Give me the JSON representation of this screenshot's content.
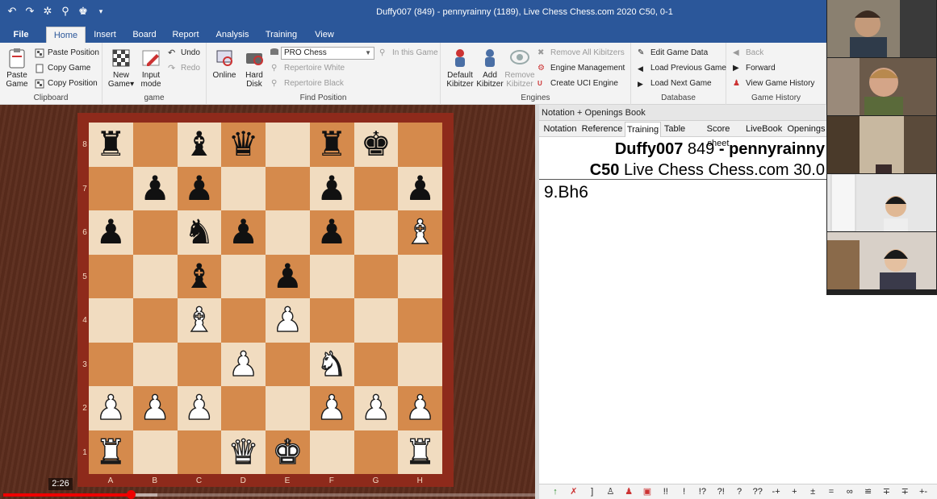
{
  "window": {
    "title": "Duffy007 (849) - pennyrainny (1189), Live Chess Chess.com 2020  C50, 0-1",
    "quick_access": [
      "undo-icon",
      "redo-icon",
      "settings-icon",
      "pin-icon",
      "theme-icon",
      "dropdown-icon"
    ]
  },
  "ribbon_tabs": [
    "File",
    "Home",
    "Insert",
    "Board",
    "Report",
    "Analysis",
    "Training",
    "View"
  ],
  "ribbon": {
    "clipboard": {
      "label": "Clipboard",
      "paste_game": "Paste Game",
      "paste_position": "Paste Position",
      "copy_game": "Copy Game",
      "copy_position": "Copy Position"
    },
    "game": {
      "label": "game",
      "new_game": "New Game",
      "input_mode": "Input mode",
      "undo": "Undo",
      "redo": "Redo"
    },
    "find": {
      "label": "Find Position",
      "online": "Online",
      "hard_disk": "Hard Disk",
      "database": "PRO Chess",
      "in_this_game": "In this Game",
      "rep_white": "Repertoire White",
      "rep_black": "Repertoire Black"
    },
    "engines": {
      "label": "Engines",
      "default_kibitzer": "Default Kibitzer",
      "add_kibitzer": "Add Kibitzer",
      "remove_kibitzer": "Remove Kibitzer",
      "remove_all": "Remove All Kibitzers",
      "engine_mgmt": "Engine Management",
      "create_uci": "Create UCI Engine"
    },
    "database": {
      "label": "Database",
      "edit_game": "Edit Game Data",
      "load_prev": "Load Previous Game",
      "load_next": "Load Next Game"
    },
    "history": {
      "label": "Game History",
      "back": "Back",
      "forward": "Forward",
      "view_history": "View Game History"
    }
  },
  "board": {
    "ranks": [
      "8",
      "7",
      "6",
      "5",
      "4",
      "3",
      "2",
      "1"
    ],
    "files": [
      "A",
      "B",
      "C",
      "D",
      "E",
      "F",
      "G",
      "H"
    ],
    "position": [
      [
        "br",
        "",
        "bb",
        "bq",
        "",
        "br",
        "bk",
        ""
      ],
      [
        "",
        "bp",
        "bp",
        "",
        "",
        "bp",
        "",
        "bp"
      ],
      [
        "bp",
        "",
        "bn",
        "bp",
        "",
        "bp",
        "",
        "wb"
      ],
      [
        "",
        "",
        "bb",
        "",
        "bp",
        "",
        "",
        ""
      ],
      [
        "",
        "",
        "wb",
        "",
        "wp",
        "",
        "",
        ""
      ],
      [
        "",
        "",
        "",
        "wp",
        "",
        "wn",
        "",
        ""
      ],
      [
        "wp",
        "wp",
        "wp",
        "",
        "",
        "wp",
        "wp",
        "wp"
      ],
      [
        "wr",
        "",
        "",
        "wq",
        "wk",
        "",
        "",
        "wr"
      ]
    ]
  },
  "video": {
    "time": "2:26",
    "progress_fraction": 0.24,
    "buffer_fraction": 0.29
  },
  "notation": {
    "header": "Notation + Openings Book",
    "tabs": [
      "Notation",
      "Reference",
      "Training",
      "Table",
      "Score sheet",
      "LiveBook",
      "Openings"
    ],
    "active_tab": "Training",
    "white_player": "Duffy007",
    "white_rating": "849",
    "dash": "-",
    "black_player": "pennyrainny",
    "eco": "C50",
    "event": "Live Chess Chess.com 30.0",
    "move": "9.Bh6"
  },
  "annotation_bar": [
    "up-arrow-icon",
    "delete-variation-icon",
    "]",
    "promote-icon",
    "demote-icon",
    "analysis-icon",
    "!!",
    "!",
    "!?",
    "?!",
    "?",
    "??",
    "-+",
    "+",
    "±",
    "=",
    "∞",
    "≌",
    "∓",
    "∓",
    "+-"
  ],
  "colors": {
    "title_bar": "#2b579a",
    "light_square": "#f1dcc0",
    "dark_square": "#d58a4c",
    "board_frame": "#8e2a1b",
    "progress": "#ee0000"
  }
}
